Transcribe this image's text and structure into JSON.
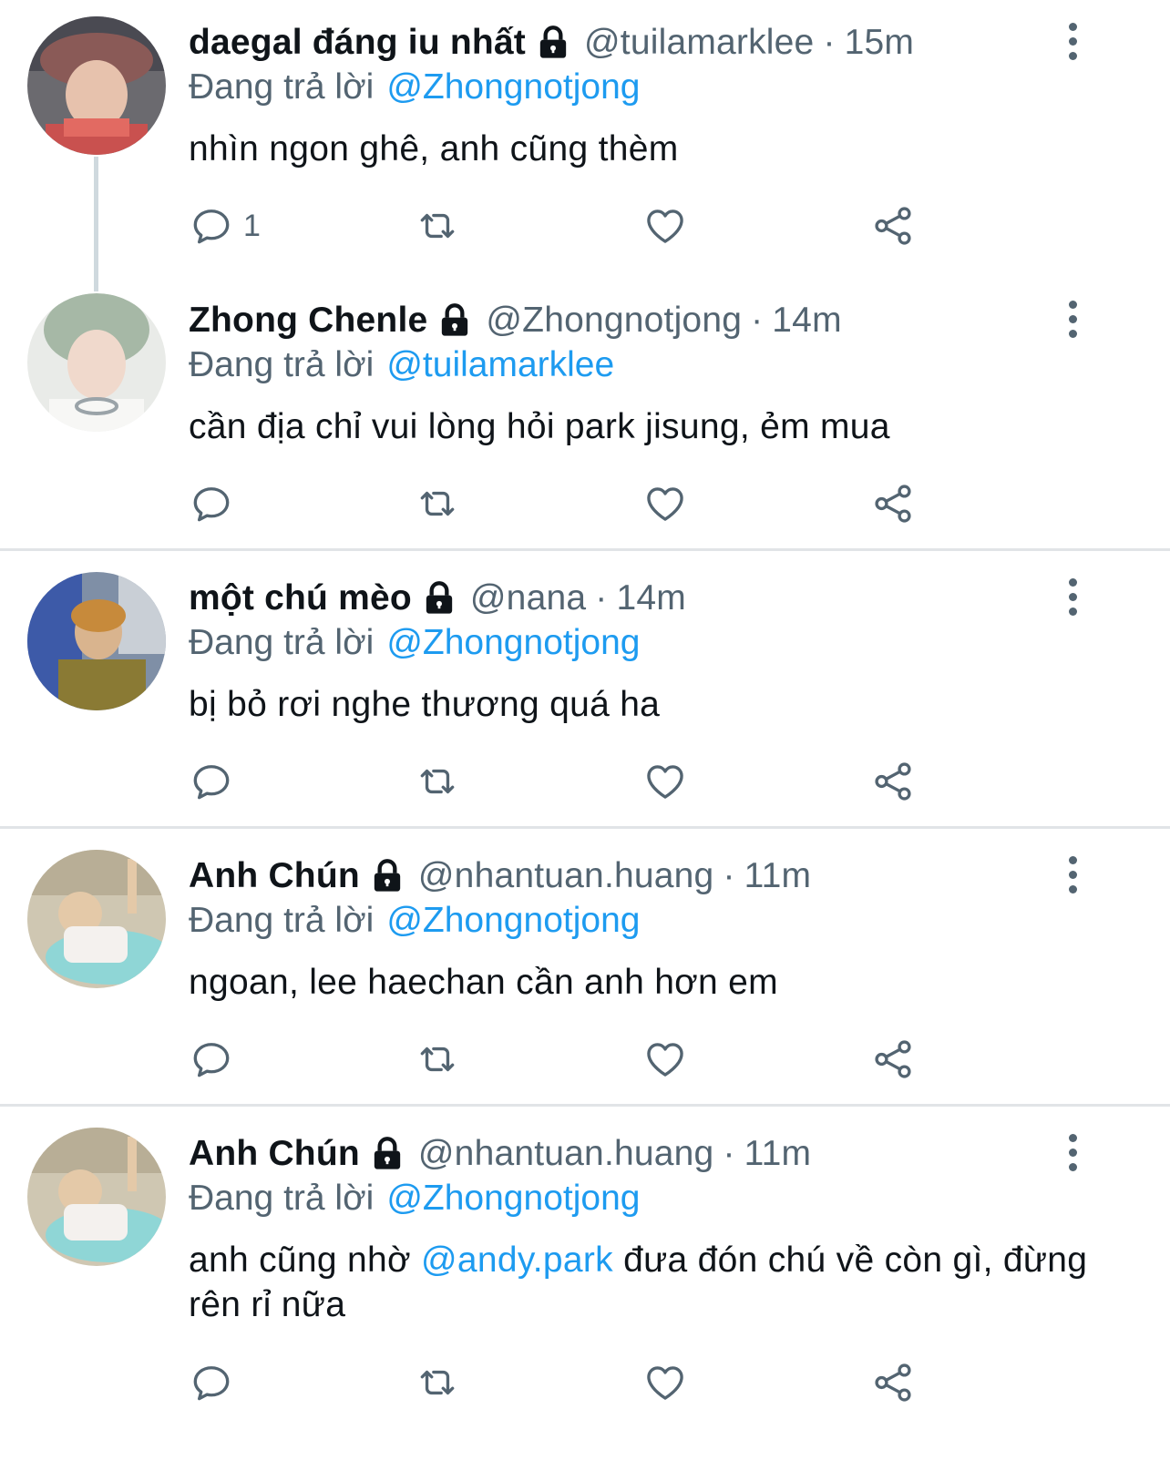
{
  "tweets": [
    {
      "name": "daegal đáng iu nhất",
      "handle": "@tuilamarklee",
      "dot": "·",
      "time": "15m",
      "reply_prefix": "Đang trả lời",
      "reply_to": "@Zhongnotjong",
      "text": "nhìn ngon ghê, anh cũng thèm",
      "reply_count": "1",
      "avatar_icon": "avatar-photo"
    },
    {
      "name": "Zhong Chenle",
      "handle": "@Zhongnotjong",
      "dot": "·",
      "time": "14m",
      "reply_prefix": "Đang trả lời",
      "reply_to": "@tuilamarklee",
      "text": "cần địa chỉ vui lòng hỏi park jisung, ẻm mua",
      "reply_count": "",
      "avatar_icon": "avatar-photo"
    },
    {
      "name": "một chú mèo",
      "handle": "@nana",
      "dot": "·",
      "time": "14m",
      "reply_prefix": "Đang trả lời",
      "reply_to": "@Zhongnotjong",
      "text": "bị bỏ rơi nghe thương quá ha",
      "reply_count": "",
      "avatar_icon": "avatar-photo"
    },
    {
      "name": "Anh Chún",
      "handle": "@nhantuan.huang",
      "dot": "·",
      "time": "11m",
      "reply_prefix": "Đang trả lời",
      "reply_to": "@Zhongnotjong",
      "text": "ngoan, lee haechan cần anh hơn em",
      "reply_count": "",
      "avatar_icon": "avatar-photo"
    },
    {
      "name": "Anh Chún",
      "handle": "@nhantuan.huang",
      "dot": "·",
      "time": "11m",
      "reply_prefix": "Đang trả lời",
      "reply_to": "@Zhongnotjong",
      "text_before": "anh cũng nhờ ",
      "text_mention": "@andy.park",
      "text_after": " đưa đón chú về còn gì, đừng rên rỉ nữa",
      "reply_count": "",
      "avatar_icon": "avatar-photo"
    }
  ],
  "colors": {
    "accent": "#1d9bf0",
    "secondary_text": "#536471",
    "primary_text": "#0f1419",
    "divider": "#e1e4e7"
  },
  "icons": {
    "lock": "lock-icon",
    "reply": "reply-icon",
    "retweet": "retweet-icon",
    "like": "heart-icon",
    "share": "share-icon",
    "more": "more-vertical-icon"
  }
}
